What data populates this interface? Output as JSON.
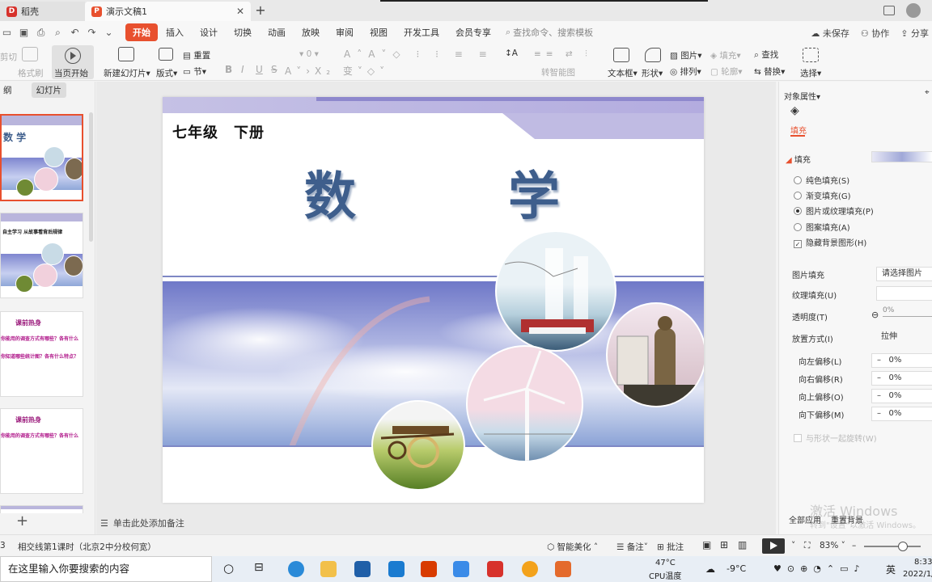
{
  "tabs": [
    {
      "label": "稻壳"
    },
    {
      "label": "演示文稿1"
    }
  ],
  "menu": {
    "items": [
      "开始",
      "插入",
      "设计",
      "切换",
      "动画",
      "放映",
      "审阅",
      "视图",
      "开发工具",
      "会员专享"
    ],
    "search_placeholder": "查找命令、搜索模板",
    "unsaved": "未保存",
    "collab": "协作",
    "share": "分享"
  },
  "ribbon": {
    "cut": "剪切",
    "format_painter": "格式刷",
    "play_from_current": "当页开始",
    "new_slide": "新建幻灯片",
    "layout": "版式",
    "reset": "重置",
    "section": "节",
    "font_size": "0",
    "bold": "B",
    "italic": "I",
    "underline": "U",
    "strike": "S",
    "smart_shape": "转智能图",
    "textbox": "文本框",
    "shape": "形状",
    "picture": "图片",
    "fill": "填充",
    "arrange": "排列",
    "outline": "轮廓",
    "find": "查找",
    "replace": "替换",
    "select": "选择"
  },
  "left_panel": {
    "tab_outline": "纲",
    "tab_slides": "幻灯片",
    "thumbs": [
      {
        "title": "数     学"
      },
      {
        "title": "自主学习  从故事看背后规律"
      },
      {
        "title": "课前热身",
        "line1": "你能用的调查方式有哪些？各有什么",
        "line2": "你知道哪些统计图？各有什么特点？"
      },
      {
        "title": "课前热身",
        "line1": "你能用的调查方式有哪些？各有什么"
      }
    ]
  },
  "slide": {
    "grade": "七年级　下册",
    "char1": "数",
    "char2": "学"
  },
  "notes_placeholder": "单击此处添加备注",
  "right_panel": {
    "header": "对象属性",
    "fill_tab": "填充",
    "section": "填充",
    "options": [
      {
        "label": "纯色填充(S)",
        "checked": false
      },
      {
        "label": "渐变填充(G)",
        "checked": false
      },
      {
        "label": "图片或纹理填充(P)",
        "checked": true
      },
      {
        "label": "图案填充(A)",
        "checked": false
      }
    ],
    "hide_bg": "隐藏背景图形(H)",
    "picture_fill": "图片填充",
    "picture_fill_value": "请选择图片",
    "texture_fill": "纹理填充(U)",
    "transparency": "透明度(T)",
    "transparency_value": "0%",
    "placement": "放置方式(I)",
    "placement_value": "拉伸",
    "offsets": [
      {
        "label": "向左偏移(L)",
        "value": "0%"
      },
      {
        "label": "向右偏移(R)",
        "value": "0%"
      },
      {
        "label": "向上偏移(O)",
        "value": "0%"
      },
      {
        "label": "向下偏移(M)",
        "value": "0%"
      }
    ],
    "rotate_with_shape": "与形状一起旋转(W)",
    "apply_all": "全部应用",
    "reset_bg": "重置背景",
    "watermark1": "激活 Windows",
    "watermark2": "转到\"设置\"以激活 Windows。"
  },
  "status": {
    "page": "3",
    "title": "相交线第1课时（北京2中分校何宽）",
    "beautify": "智能美化",
    "notes": "备注",
    "comment": "批注",
    "zoom": "83%"
  },
  "taskbar": {
    "search": "在这里输入你要搜索的内容",
    "temp_cpu": "47°C",
    "cpu_label": "CPU温度",
    "weather": "-9°C",
    "ime": "英",
    "time": "8:33",
    "date": "2022/1/"
  },
  "colors": {
    "accent": "#e8502e",
    "title_blue": "#3e5e8c"
  }
}
